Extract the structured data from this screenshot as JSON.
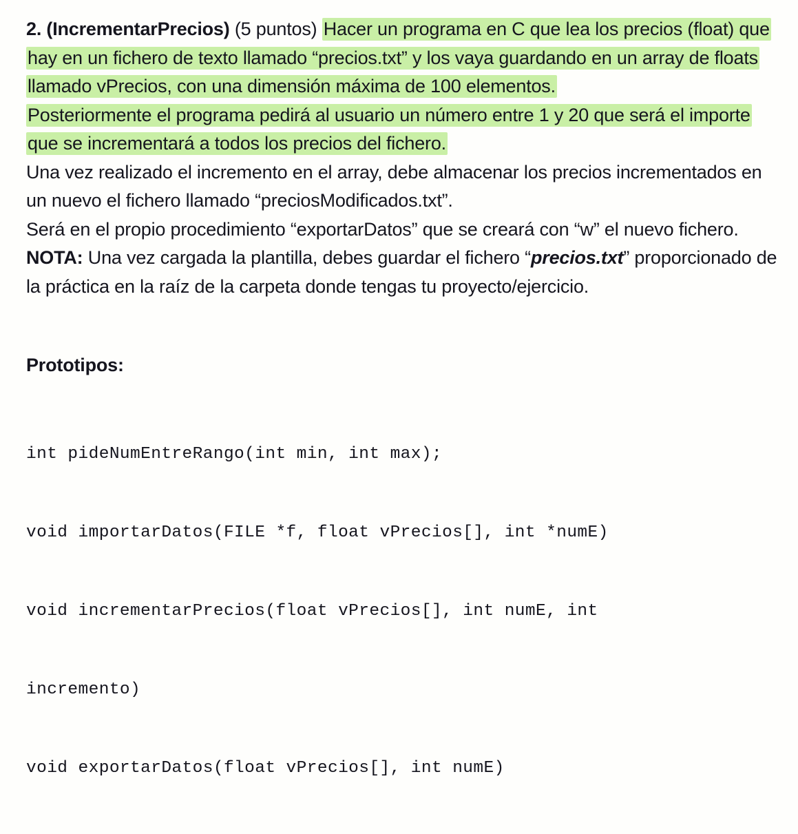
{
  "document": {
    "background_color": "#FEFEFC",
    "text_color": "#15151E",
    "highlight_color": "#C9EFA6"
  },
  "exercise": {
    "number_and_name": "2. (IncrementarPrecios)",
    "points": "(5 puntos)",
    "highlighted_paragraph_1": "Hacer un programa en C que lea los precios (float) que hay en un fichero de texto llamado “precios.txt” y los vaya guardando en un array de floats llamado vPrecios, con una dimensión máxima de 100 elementos.",
    "highlighted_paragraph_2": "Posteriormente el programa pedirá al usuario un número entre 1 y 20 que será el importe que se incrementará a todos los precios del fichero.",
    "paragraph_3": "Una vez realizado el incremento en el array, debe almacenar los precios incrementados en un nuevo el fichero llamado “preciosModificados.txt”.",
    "paragraph_4": "Será en el propio procedimiento “exportarDatos” que se creará con “w” el nuevo fichero.",
    "note": {
      "label": "NOTA:",
      "text_before_file": " Una vez cargada la plantilla, debes guardar el fichero “",
      "file_name": "precios.txt",
      "text_after_file": "” proporcionado de la práctica en la raíz de la carpeta donde tengas tu proyecto/ejercicio."
    }
  },
  "prototypes": {
    "heading": "Prototipos:",
    "lines": [
      "int pideNumEntreRango(int min, int max);",
      "void importarDatos(FILE *f, float vPrecios[], int *numE)",
      "void incrementarPrecios(float vPrecios[], int numE, int",
      "incremento)",
      "void exportarDatos(float vPrecios[], int numE)"
    ]
  }
}
